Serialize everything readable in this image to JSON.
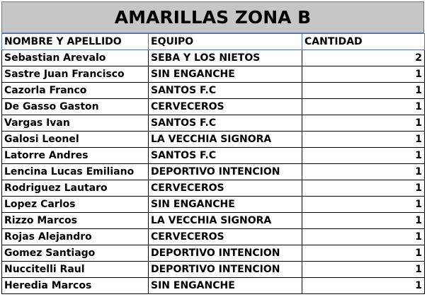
{
  "title": "AMARILLAS ZONA B",
  "headers": [
    "NOMBRE Y APELLIDO",
    "EQUIPO",
    "CANTIDAD"
  ],
  "rows": [
    [
      "Sebastian Arevalo",
      "SEBA Y LOS NIETOS",
      "2"
    ],
    [
      "Sastre Juan Francisco",
      "SIN ENGANCHE",
      "1"
    ],
    [
      "Cazorla Franco",
      "SANTOS F.C",
      "1"
    ],
    [
      "De Gasso Gaston",
      "CERVECEROS",
      "1"
    ],
    [
      "Vargas Ivan",
      "SANTOS F.C",
      "1"
    ],
    [
      "Galosi Leonel",
      "LA VECCHIA SIGNORA",
      "1"
    ],
    [
      "Latorre Andres",
      "SANTOS F.C",
      "1"
    ],
    [
      "Lencina Lucas Emiliano",
      "DEPORTIVO INTENCION",
      "1"
    ],
    [
      "Rodriguez Lautaro",
      "CERVECEROS",
      "1"
    ],
    [
      "Lopez Carlos",
      "SIN ENGANCHE",
      "1"
    ],
    [
      "Rizzo Marcos",
      "LA VECCHIA SIGNORA",
      "1"
    ],
    [
      "Rojas Alejandro",
      "CERVECEROS",
      "1"
    ],
    [
      "Gomez Santiago",
      "DEPORTIVO INTENCION",
      "1"
    ],
    [
      "Nuccitelli Raul",
      "DEPORTIVO INTENCION",
      "1"
    ],
    [
      "Heredia Marcos",
      "SIN ENGANCHE",
      "1"
    ]
  ]
}
